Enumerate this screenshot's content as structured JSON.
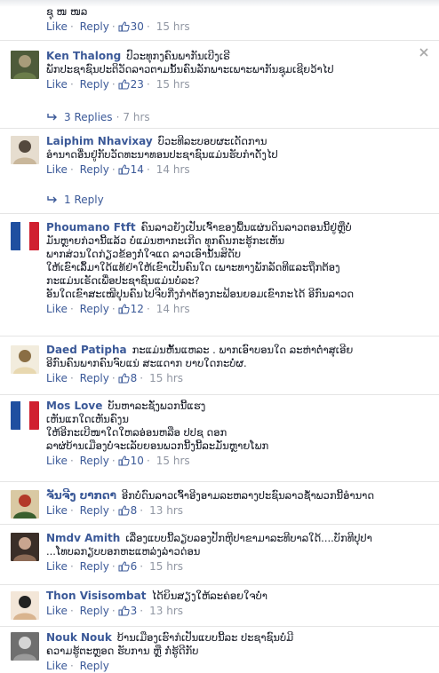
{
  "actions": {
    "like": "Like",
    "reply": "Reply"
  },
  "comments": [
    {
      "author": "",
      "lines": [
        "ຊຸ ໜ ໜລ"
      ],
      "likes": "30",
      "time": "15 hrs"
    },
    {
      "author": "Ken Thalong",
      "lines": [
        "ປົວະທຸກງຄົນພາກັນເບີງເຣີ",
        "ພັກປະຊາຊົນປະຕິວັດລາວຕາມນັ້ນຄົນລັກພາະເພາະພາກັນຊຸມເຊີຍວ້າໄປ"
      ],
      "likes": "23",
      "time": "15 hrs",
      "replies": "3 Replies",
      "replies_time": "7 hrs"
    },
    {
      "author": "Laiphim Nhavixay",
      "lines": [
        "ບົວະທີລະບອບຜະເດັດການ",
        "ອຳນາດອື່ນຢູ່ກັບວັດທະນາທອນປະຊາຊົນແມ່ນຮັບກຳດັ່ງໄປ"
      ],
      "likes": "14",
      "time": "14 hrs",
      "replies": "1 Reply"
    },
    {
      "author": "Phoumano Ftft",
      "lines": [
        "ຄົນລາວຍັງເປັນເຈົ້າຂອງພື້ນແຜ່ນດິນລາວຕອນນີ້ຢູ່ຫຼືບໍ່",
        "ມັນຫຼາຍກ່ວານີ້ແລ້ວ ບໍ່ແມ່ນຫາກະເກີດ ທຸກຄົນກະຮູ້ກະເຫັນ",
        "ພາກສ່ວນໃດກ່ຽວຂ້ອງກໍ່ໃຈແດ ລາວເອົານັ້ນສິດັບ",
        "ໃຫ້ເຂົາເລຶ້ມາໃດ້ແທ້ຢ່າໃຫ້ເຂົາເປັນຄົນໃດ ເພາະທາງພັກລັດທີແລະຖືກຕ້ອງ",
        "ກະແມ່ນເຣັດເພື່ອປະຊາຊົນແມ່ນບໍ່ລະ?",
        "ອັນໃດເຂົາສະເໜີປຸນຄົນໄປຈີບກີ່ງກຳຕ້ອງກະຟ້ອນຍອມເຂົາກະໄດ້ ອີກົນລາວດ"
      ],
      "likes": "12",
      "time": "14 hrs"
    },
    {
      "author": "Daed Patipha",
      "lines": [
        "ກະແມ່ນຫັ້ນແຫລະ . ພາກເອົາບອນໃດ ລະຫ່າຕ່ຳສຸເອີຍ",
        "ອີກົນຄົນພາກຄົນຈົບແນ່ ສະແດາກ ບາບໃດກະບໍ່ຜ."
      ],
      "likes": "8",
      "time": "15 hrs"
    },
    {
      "author": "Mos Love",
      "lines": [
        "ບັນຫາລະຊັ່ງພວກນີ້ແຮງ",
        "ເຫັນແກໃດເຫັນຄົງນ",
        "ໃຫ້ອີກະເບີໜາໃດໃຫລອ່ອນຫລືອ ປປຊ ດອກ",
        "ລາຜ່ບ້ານເມືອງບໍ່ຈະເລັບຍອນພວກນີ້ງນີ້ລະມັ່ນຫຼາຍໂພກ"
      ],
      "likes": "10",
      "time": "15 hrs"
    },
    {
      "author": "ຈັນຈີງ ບາກດາ",
      "lines": [
        "ອີກບໍ່ດົນລາວເຈົ້າອີງອາມລະຫລາງປະຊົນລາວຊ້ຳພວກນີ້ອຳນາດ"
      ],
      "likes": "8",
      "time": "13 hrs"
    },
    {
      "author": "Nmdv Amith",
      "lines": [
        "ເລື່ອງແບບນີ້ລຽບລອງປັກຫີຸປາຂາມາລະທີບາລໃດ້....ບັກທີປຸປາ",
        "...ໂທບລກຽບບອກຫະແຫລ່ງລ່າວດ່ອນ"
      ],
      "likes": "6",
      "time": "15 hrs"
    },
    {
      "author": "Thon Visisombat",
      "lines": [
        "ໄດ້ຍິນສຽງໃຫ້ລະຄ່ອຍໃຈບໍ່າ"
      ],
      "likes": "3",
      "time": "13 hrs"
    },
    {
      "author": "Nouk Nouk",
      "lines": [
        "ບ້ານເມືອງເຮົາກໍເປັນແບບນີ້ລະ ປະຊາຊົນບໍ່ມີ",
        "ຄວາມຮູ້ຕະຫຼອດ ຮັບການ ຫຼື ກໍ່ຮູ້ດີກັບ"
      ],
      "likes": "",
      "time": ""
    }
  ]
}
